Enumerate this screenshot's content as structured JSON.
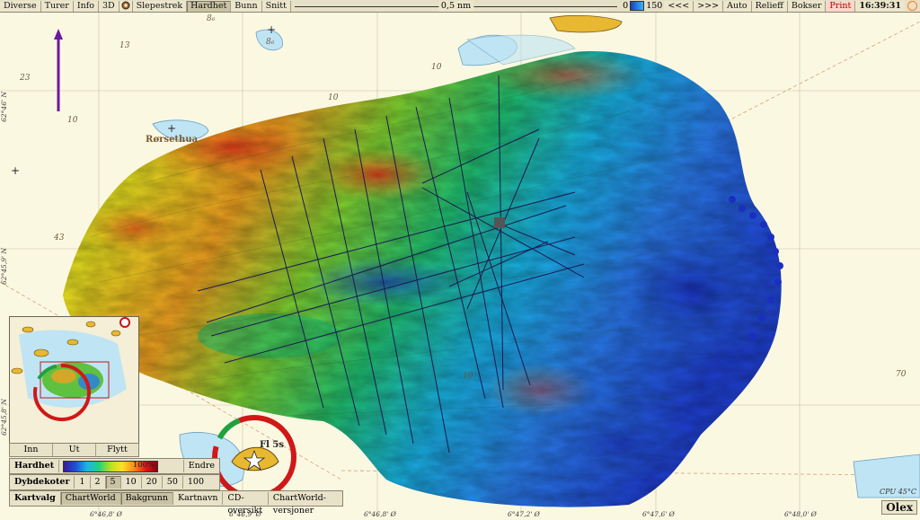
{
  "toolbar": {
    "items": [
      "Diverse",
      "Turer",
      "Info",
      "3D",
      "Slepestrek",
      "Hardhet",
      "Bunn",
      "Snitt"
    ],
    "active": "Hardhet",
    "scale_label": "0,5 nm",
    "depth_min": "0",
    "depth_max": "150",
    "nav_back": "<<<",
    "nav_fwd": ">>>",
    "auto": "Auto",
    "relief": "Relieff",
    "bokser": "Bokser",
    "print": "Print",
    "time": "16:39:31"
  },
  "map": {
    "place_name": "Rørsethua",
    "beacon_label": "Fl 5s",
    "depth_labels": [
      "13",
      "10",
      "23",
      "10",
      "10",
      "43",
      "10",
      "70",
      "8₆",
      "8₆"
    ],
    "top_coords": [
      "6°46,8' Ø",
      "6°46,9' Ø",
      "6°46,8' Ø",
      "6°47,0' Ø",
      "6°47,2' Ø",
      "6°47,6' Ø",
      "6°48,0' Ø"
    ],
    "left_coords": [
      "62°46' N",
      "62°45,9' N",
      "62°45,8' N"
    ],
    "cpu": "CPU 45°C",
    "brand": "Olex",
    "colors": {
      "land": "#fbf8e2",
      "shallow": "#bfe4f4",
      "hard": "#e01818",
      "soft": "#1d4fd9",
      "track": "#1a1a50"
    }
  },
  "minimap": {
    "buttons": [
      "Inn",
      "Ut",
      "Flytt"
    ]
  },
  "panel": {
    "hardhet_label": "Hardhet",
    "hardhet_scale_pct": "100%",
    "endre": "Endre",
    "dybdekoter_label": "Dybdekoter",
    "dybdekoter_options": [
      "1",
      "2",
      "5",
      "10",
      "20",
      "50",
      "100"
    ],
    "dybdekoter_selected": "5",
    "kartvalg_label": "Kartvalg",
    "kartvalg_options": [
      "ChartWorld",
      "Bakgrunn",
      "Kartnavn",
      "CD-oversikt",
      "ChartWorld-versjoner"
    ],
    "kartvalg_selected": [
      "ChartWorld",
      "Bakgrunn"
    ]
  }
}
